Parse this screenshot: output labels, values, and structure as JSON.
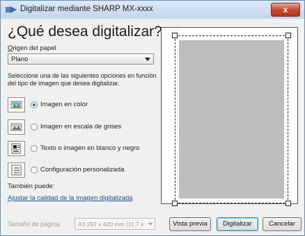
{
  "window": {
    "title": "Digitalizar mediante SHARP MX-xxxx",
    "close_label": "x"
  },
  "main": {
    "heading": "¿Qué desea digitalizar?",
    "origin_label_first": "O",
    "origin_label_rest": "rigen del papel",
    "origin_value": "Plano",
    "instructions": "Seleccione una de las siguientes opciones en función del tipo de imagen que desea digitalizar."
  },
  "options": [
    {
      "label": "Imagen en color",
      "checked": true,
      "icon": "color-photo-icon"
    },
    {
      "label": "Imagen en escala de grises",
      "checked": false,
      "icon": "grayscale-photo-icon"
    },
    {
      "label": "Texto o imagen en blanco y negro",
      "checked": false,
      "icon": "black-white-text-icon"
    },
    {
      "label": "Configuración personalizada",
      "checked": false,
      "icon": "custom-settings-icon"
    }
  ],
  "also": {
    "label": "También puede:",
    "link": "Ajustar la calidad de la imagen digitalizada"
  },
  "footer": {
    "page_size_label": "Tamaño de página:",
    "page_size_value": "A3 297 x 420 mm (11.7 x",
    "preview_button": "Vista previa",
    "scan_button": "Digitalizar",
    "cancel_button": "Cancelar"
  }
}
